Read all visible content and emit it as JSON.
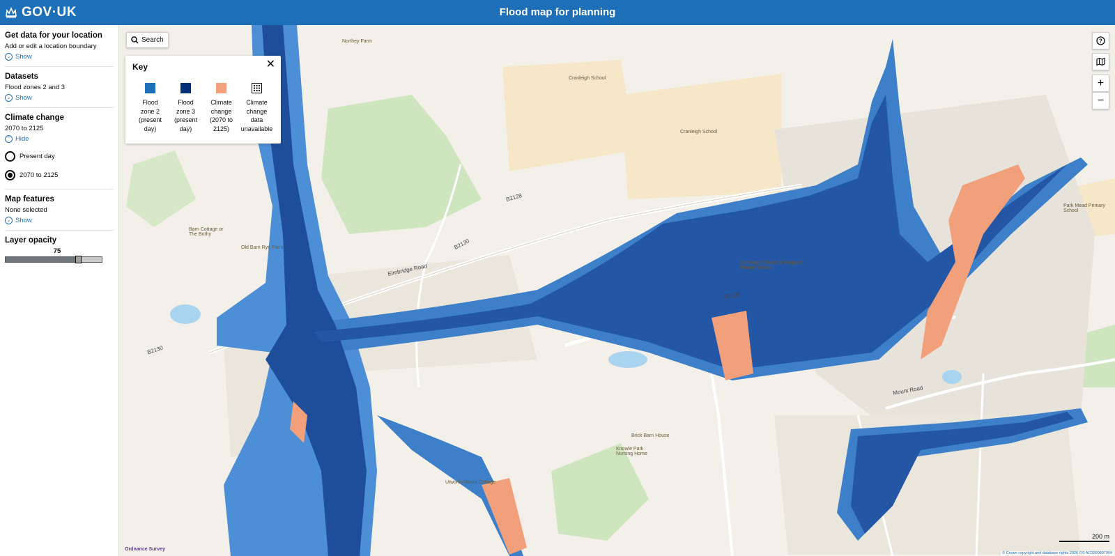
{
  "header": {
    "logo_text": "GOV·UK",
    "title": "Flood map for planning"
  },
  "sidebar": {
    "location": {
      "heading": "Get data for your location",
      "text": "Add or edit a location boundary",
      "toggle": "Show"
    },
    "datasets": {
      "heading": "Datasets",
      "text": "Flood zones 2 and 3",
      "toggle": "Show"
    },
    "climate": {
      "heading": "Climate change",
      "text": "2070 to 2125",
      "toggle": "Hide",
      "options": [
        {
          "label": "Present day",
          "checked": false
        },
        {
          "label": "2070 to 2125",
          "checked": true
        }
      ]
    },
    "features": {
      "heading": "Map features",
      "text": "None selected",
      "toggle": "Show"
    },
    "opacity": {
      "heading": "Layer opacity",
      "value": "75",
      "level_percent": 75
    }
  },
  "map": {
    "search_label": "Search",
    "key": {
      "title": "Key",
      "items": [
        {
          "label_lines": [
            "Flood",
            "zone 2",
            "(present",
            "day)"
          ],
          "color": "#1d70b8"
        },
        {
          "label_lines": [
            "Flood",
            "zone 3",
            "(present",
            "day)"
          ],
          "color": "#003078"
        },
        {
          "label_lines": [
            "Climate",
            "change",
            "(2070 to",
            "2125)"
          ],
          "color": "#f4a27e"
        },
        {
          "label_lines": [
            "Climate",
            "change",
            "data",
            "unavailable"
          ],
          "color": "pattern"
        }
      ]
    },
    "place_labels": {
      "northfield": "Northey Farm",
      "school1": "Cranleigh School",
      "school2": "Cranleigh School",
      "barn": "Barn Cottage or The Bothy",
      "oldbarn": "Old Barn Rye Farm",
      "church": "Cranleigh Church of England Primary School",
      "brickbarn": "Brick Barn House",
      "knowle": "Knowle Park Nursing Home",
      "utworth": "Utworth Manor Cottage",
      "parkmead": "Park Mead Primary School"
    },
    "road_labels": {
      "b2128a": "B2128",
      "b2130a": "B2130",
      "b2130b": "B2130",
      "b2128b": "B2128",
      "elmbridge": "Elmbridge Road",
      "mount": "Mount Road"
    },
    "scale_label": "200 m",
    "copyright": "© Crown copyright and database rights 2026 OS AC0000807064",
    "os_logo": "Ordnance Survey"
  }
}
